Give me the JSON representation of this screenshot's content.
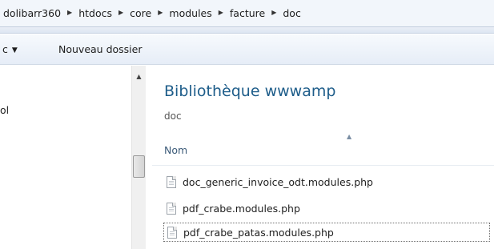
{
  "breadcrumb": [
    "dolibarr360",
    "htdocs",
    "core",
    "modules",
    "facture",
    "doc"
  ],
  "toolbar": {
    "organize_label": "c",
    "new_folder_label": "Nouveau dossier"
  },
  "navpane": {
    "items": [
      {
        "label": "ol"
      }
    ]
  },
  "library": {
    "title": "Bibliothèque wwwamp",
    "subtitle": "doc"
  },
  "columns": {
    "name": "Nom"
  },
  "files": [
    {
      "name": "doc_generic_invoice_odt.modules.php"
    },
    {
      "name": "pdf_crabe.modules.php"
    },
    {
      "name": "pdf_crabe_patas.modules.php"
    }
  ],
  "icons": {
    "breadcrumb_separator": "triangle-right-icon",
    "dropdown": "caret-down-icon",
    "file": "php-file-icon",
    "scroll_up": "scroll-up-arrow-icon",
    "sort": "sort-ascending-icon"
  },
  "colors": {
    "title_blue": "#1e5d8a",
    "header_text": "#3b5a78"
  }
}
